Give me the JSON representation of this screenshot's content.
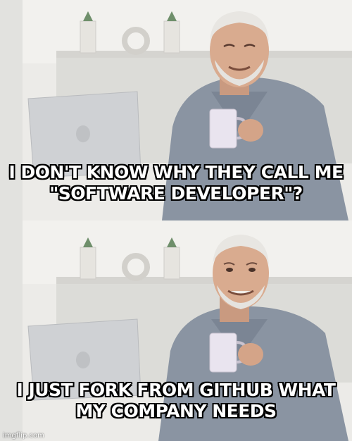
{
  "meme": {
    "top_caption": "I DON'T KNOW WHY THEY CALL ME \"SOFTWARE DEVELOPER\"?",
    "bottom_caption": "I JUST FORK FROM GITHUB WHAT MY COMPANY NEEDS",
    "watermark": "imgflip.com"
  },
  "colors": {
    "wall": "#e9e9e6",
    "shelf": "#d9d8d4",
    "shirt": "#8a94a2",
    "skin": "#d9ab8f",
    "hair": "#e8e6e2",
    "mug": "#e9e4ef",
    "laptop": "#cfd1d4",
    "text": "#ffffff",
    "text_outline": "#000000"
  }
}
